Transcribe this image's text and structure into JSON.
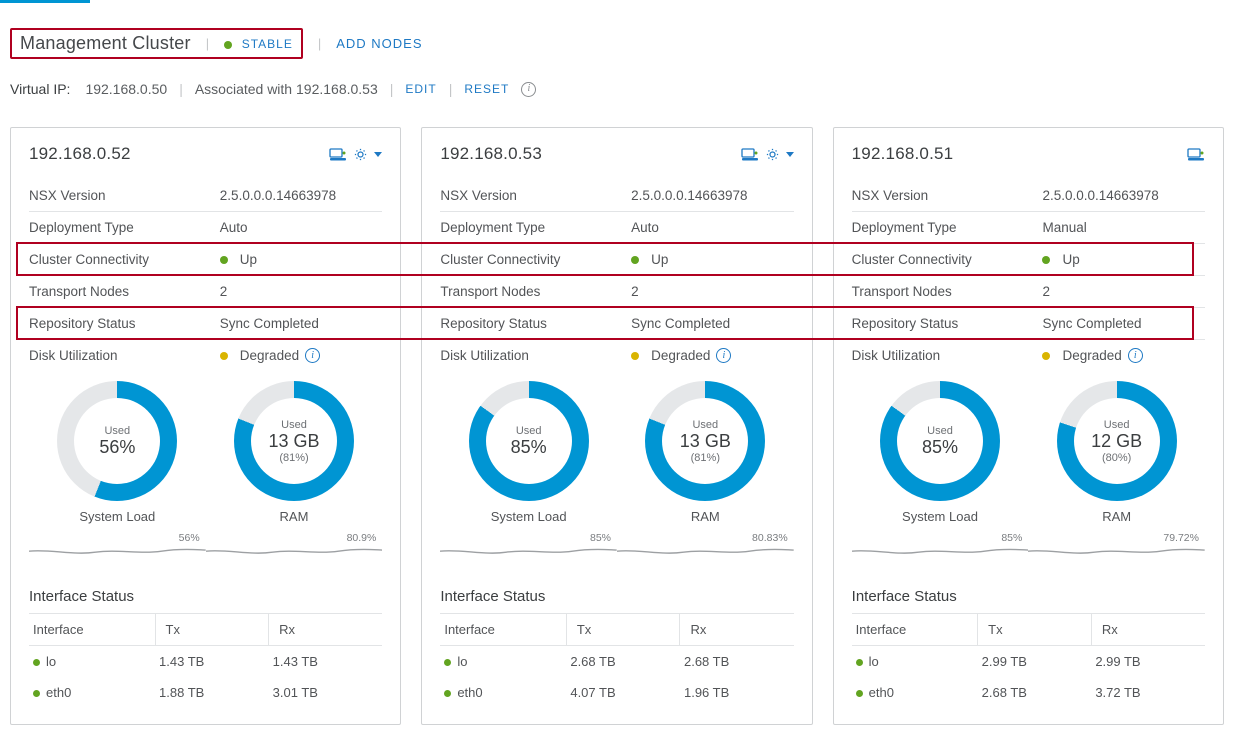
{
  "header": {
    "title": "Management Cluster",
    "status_label": "STABLE",
    "add_nodes_label": "ADD NODES"
  },
  "vip": {
    "label": "Virtual IP:",
    "ip": "192.168.0.50",
    "assoc_prefix": "Associated with",
    "assoc_ip": "192.168.0.53",
    "edit_label": "EDIT",
    "reset_label": "RESET"
  },
  "row_labels": {
    "nsx_version": "NSX Version",
    "deployment_type": "Deployment Type",
    "cluster_connectivity": "Cluster Connectivity",
    "transport_nodes": "Transport Nodes",
    "repository_status": "Repository Status",
    "disk_utilization": "Disk Utilization",
    "interface_status": "Interface Status",
    "interface": "Interface",
    "tx": "Tx",
    "rx": "Rx",
    "used": "Used",
    "system_load": "System Load",
    "ram": "RAM"
  },
  "nodes": [
    {
      "ip": "192.168.0.52",
      "nsx_version": "2.5.0.0.0.14663978",
      "deployment_type": "Auto",
      "connectivity": "Up",
      "transport_nodes": "2",
      "repo_status": "Sync Completed",
      "disk_status": "Degraded",
      "load_pct": 56,
      "load_label": "56%",
      "ram_used": "13 GB",
      "ram_pct": 81,
      "ram_pct_label": "(81%)",
      "spark1": "56%",
      "spark2": "80.9%",
      "interfaces": [
        {
          "name": "lo",
          "tx": "1.43 TB",
          "rx": "1.43 TB"
        },
        {
          "name": "eth0",
          "tx": "1.88 TB",
          "rx": "3.01 TB"
        }
      ]
    },
    {
      "ip": "192.168.0.53",
      "nsx_version": "2.5.0.0.0.14663978",
      "deployment_type": "Auto",
      "connectivity": "Up",
      "transport_nodes": "2",
      "repo_status": "Sync Completed",
      "disk_status": "Degraded",
      "load_pct": 85,
      "load_label": "85%",
      "ram_used": "13 GB",
      "ram_pct": 81,
      "ram_pct_label": "(81%)",
      "spark1": "85%",
      "spark2": "80.83%",
      "interfaces": [
        {
          "name": "lo",
          "tx": "2.68 TB",
          "rx": "2.68 TB"
        },
        {
          "name": "eth0",
          "tx": "4.07 TB",
          "rx": "1.96 TB"
        }
      ]
    },
    {
      "ip": "192.168.0.51",
      "nsx_version": "2.5.0.0.0.14663978",
      "deployment_type": "Manual",
      "connectivity": "Up",
      "transport_nodes": "2",
      "repo_status": "Sync Completed",
      "disk_status": "Degraded",
      "load_pct": 85,
      "load_label": "85%",
      "ram_used": "12 GB",
      "ram_pct": 80,
      "ram_pct_label": "(80%)",
      "spark1": "85%",
      "spark2": "79.72%",
      "interfaces": [
        {
          "name": "lo",
          "tx": "2.99 TB",
          "rx": "2.99 TB"
        },
        {
          "name": "eth0",
          "tx": "2.68 TB",
          "rx": "3.72 TB"
        }
      ]
    }
  ],
  "chart_data": {
    "type": "table",
    "title": "Node resource utilization",
    "columns": [
      "node_ip",
      "system_load_pct",
      "ram_used_gb",
      "ram_used_pct"
    ],
    "rows": [
      [
        "192.168.0.52",
        56,
        13,
        81
      ],
      [
        "192.168.0.53",
        85,
        13,
        81
      ],
      [
        "192.168.0.51",
        85,
        12,
        80
      ]
    ]
  }
}
